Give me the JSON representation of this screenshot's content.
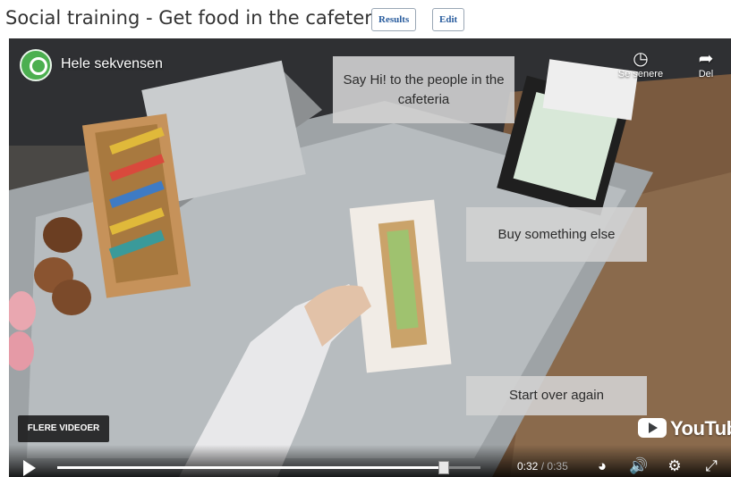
{
  "page": {
    "title": "Social training - Get food in the cafeteria",
    "results_label": "Results",
    "edit_label": "Edit"
  },
  "video": {
    "channel_title": "Hele sekvensen",
    "watch_later_label": "Se senere",
    "share_label": "Del",
    "choices": [
      "Say Hi! to the people in the cafeteria",
      "Buy something else",
      "Start over again"
    ],
    "more_videos_label": "FLERE VIDEOER",
    "brand": "YouTube",
    "current_time": "0:32",
    "separator": "/",
    "duration": "0:35",
    "progress": 0.914,
    "icons": {
      "logo": "channel-logo-icon",
      "watch_later": "clock-icon",
      "share": "share-arrow-icon",
      "play": "play-icon",
      "speed": "playback-speed-icon",
      "volume": "volume-icon",
      "settings": "gear-icon",
      "fullscreen": "fullscreen-icon"
    }
  }
}
